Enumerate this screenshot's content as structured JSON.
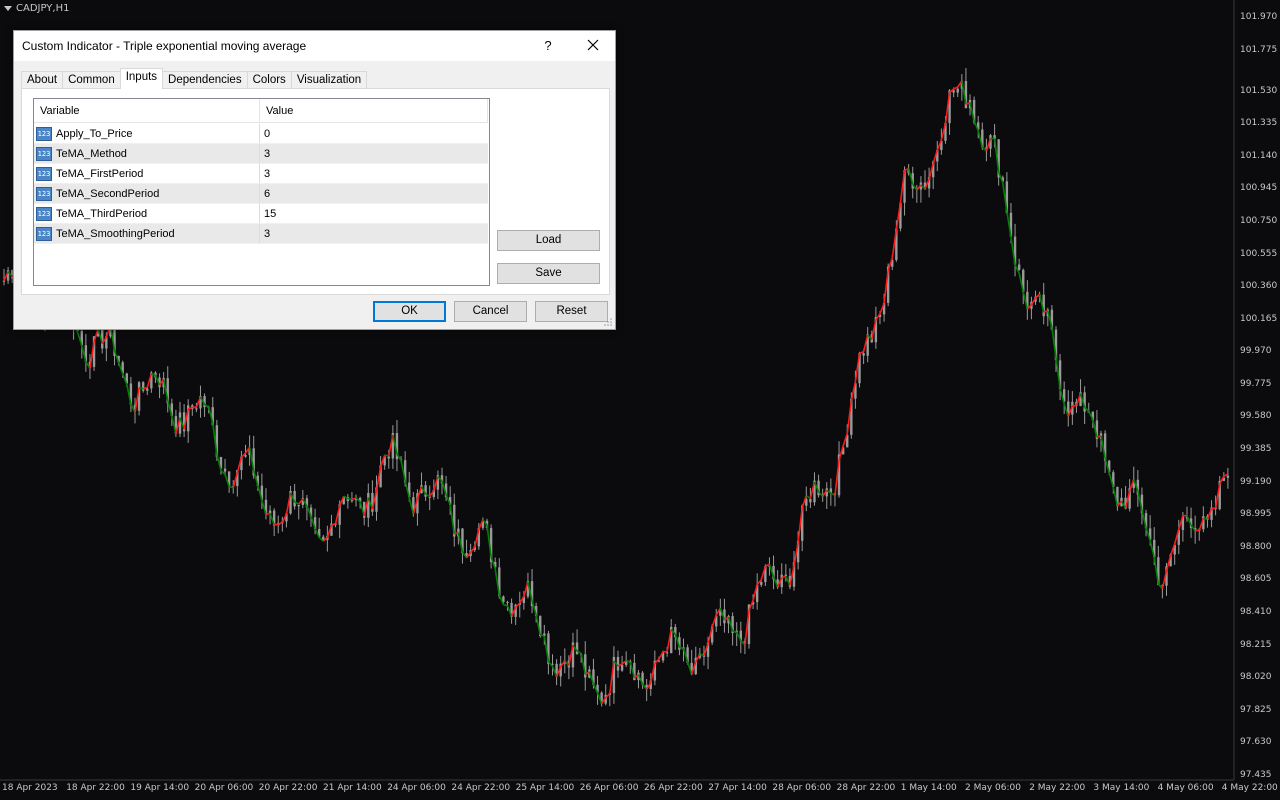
{
  "chart": {
    "symbol": "CADJPY,H1",
    "colors": {
      "background": "#0b0b0e",
      "candle": "#9a9a9a",
      "tema_up": "#008000",
      "tema_down": "#ff1a1a"
    },
    "price_labels": [
      "101.970",
      "101.775",
      "101.530",
      "101.335",
      "101.140",
      "100.945",
      "100.750",
      "100.555",
      "100.360",
      "100.165",
      "99.970",
      "99.775",
      "99.580",
      "99.385",
      "99.190",
      "98.995",
      "98.800",
      "98.605",
      "98.410",
      "98.215",
      "98.020",
      "97.825",
      "97.630",
      "97.435"
    ],
    "time_labels": [
      "18 Apr 2023",
      "18 Apr 22:00",
      "19 Apr 14:00",
      "20 Apr 06:00",
      "20 Apr 22:00",
      "21 Apr 14:00",
      "24 Apr 06:00",
      "24 Apr 22:00",
      "25 Apr 14:00",
      "26 Apr 06:00",
      "26 Apr 22:00",
      "27 Apr 14:00",
      "28 Apr 06:00",
      "28 Apr 22:00",
      "1 May 14:00",
      "2 May 06:00",
      "2 May 22:00",
      "3 May 14:00",
      "4 May 06:00",
      "4 May 22:00"
    ]
  },
  "chart_data": {
    "type": "line",
    "title": "CADJPY,H1",
    "xlabel": "",
    "ylabel": "",
    "ylim": [
      97.435,
      101.97
    ],
    "x": [
      "18 Apr 2023",
      "18 Apr 22:00",
      "19 Apr 14:00",
      "20 Apr 06:00",
      "20 Apr 22:00",
      "21 Apr 14:00",
      "24 Apr 06:00",
      "24 Apr 22:00",
      "25 Apr 14:00",
      "26 Apr 06:00",
      "26 Apr 22:00",
      "27 Apr 14:00",
      "28 Apr 06:00",
      "28 Apr 22:00",
      "1 May 14:00",
      "2 May 06:00",
      "2 May 22:00",
      "3 May 14:00",
      "4 May 06:00",
      "4 May 22:00"
    ],
    "series": [
      {
        "values": [
          100.4,
          100.2,
          99.8,
          99.6,
          99.1,
          98.9,
          99.3,
          99.0,
          98.5,
          98.0,
          98.1,
          98.2,
          98.6,
          99.4,
          100.9,
          101.6,
          100.2,
          99.4,
          98.7,
          99.2
        ]
      }
    ],
    "grid": false,
    "legend": "none"
  },
  "dialog": {
    "title": "Custom Indicator - Triple exponential moving average",
    "help": "?",
    "tabs": [
      "About",
      "Common",
      "Inputs",
      "Dependencies",
      "Colors",
      "Visualization"
    ],
    "active_tab": "Inputs",
    "table": {
      "headers": {
        "variable": "Variable",
        "value": "Value"
      },
      "icon_text": "123",
      "rows": [
        {
          "variable": "Apply_To_Price",
          "value": "0"
        },
        {
          "variable": "TeMA_Method",
          "value": "3"
        },
        {
          "variable": "TeMA_FirstPeriod",
          "value": "3"
        },
        {
          "variable": "TeMA_SecondPeriod",
          "value": "6"
        },
        {
          "variable": "TeMA_ThirdPeriod",
          "value": "15"
        },
        {
          "variable": "TeMA_SmoothingPeriod",
          "value": "3"
        }
      ]
    },
    "buttons": {
      "load": "Load",
      "save": "Save",
      "ok": "OK",
      "cancel": "Cancel",
      "reset": "Reset"
    }
  }
}
